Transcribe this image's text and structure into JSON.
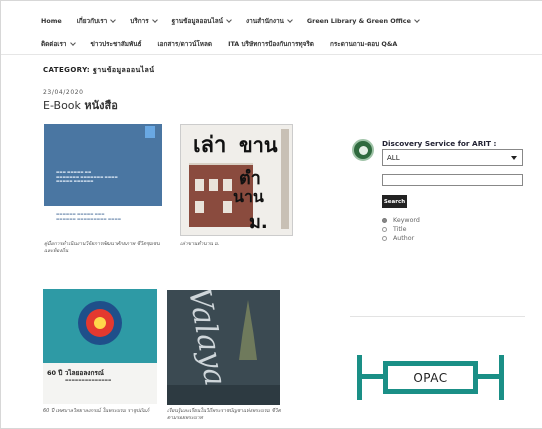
{
  "nav": {
    "row1": [
      {
        "label": "Home",
        "dropdown": false
      },
      {
        "label": "เกี่ยวกับเรา",
        "dropdown": true
      },
      {
        "label": "บริการ",
        "dropdown": true
      },
      {
        "label": "ฐานข้อมูลออนไลน์",
        "dropdown": true
      },
      {
        "label": "งานสำนักงาน",
        "dropdown": true
      },
      {
        "label": "Green Library & Green Office",
        "dropdown": true
      }
    ],
    "row2": [
      {
        "label": "ติดต่อเรา",
        "dropdown": true
      },
      {
        "label": "ข่าวประชาสัมพันธ์",
        "dropdown": false
      },
      {
        "label": "เอกสาร/ดาวน์โหลด",
        "dropdown": false
      },
      {
        "label": "ITA บริษัทการป้องกันการทุจริต",
        "dropdown": false
      },
      {
        "label": "กระดานถาม-ตอบ Q&A",
        "dropdown": false
      }
    ]
  },
  "category_label": "CATEGORY: ฐานข้อมูลออนไลน์",
  "post": {
    "date": "23/04/2020",
    "title_en": "E-Book",
    "title_th": "หนังสือ"
  },
  "books": [
    {
      "caption": "คู่มือการดำเนินงานวิจัยการพัฒนาศักยภาพ ชีวิตชุมชนและท้องถิ่น"
    },
    {
      "caption": "เล่าขานตำนาน ม.",
      "cover_text": [
        "เล่า",
        "ขาน",
        "ตำ",
        "นาน",
        "ม."
      ]
    },
    {
      "caption": "60 ปี เทศบาลวิทยาลงกรณ์ ในพระบรม ราชูปถัมภ์",
      "cover_text": "วไลยอลงกรณ์"
    },
    {
      "caption": "เรียนรู้และเรียนในวิถีพระราชบัญชาแห่งพระบรม ชีวิตตามรอยพระบาท",
      "cover_text": "Valaya"
    }
  ],
  "sidebar": {
    "discovery_title": "Discovery Service for ARIT :",
    "select_value": "ALL",
    "search_input_value": "",
    "search_button": "Search",
    "radios": [
      {
        "label": "Keyword",
        "checked": true
      },
      {
        "label": "Title",
        "checked": false
      },
      {
        "label": "Author",
        "checked": false
      }
    ],
    "opac_label": "OPAC"
  },
  "colors": {
    "opac_teal": "#1a8f86",
    "book1_blue": "#4a76a2",
    "book3_teal": "#2e9aa5",
    "search_button": "#222222"
  }
}
